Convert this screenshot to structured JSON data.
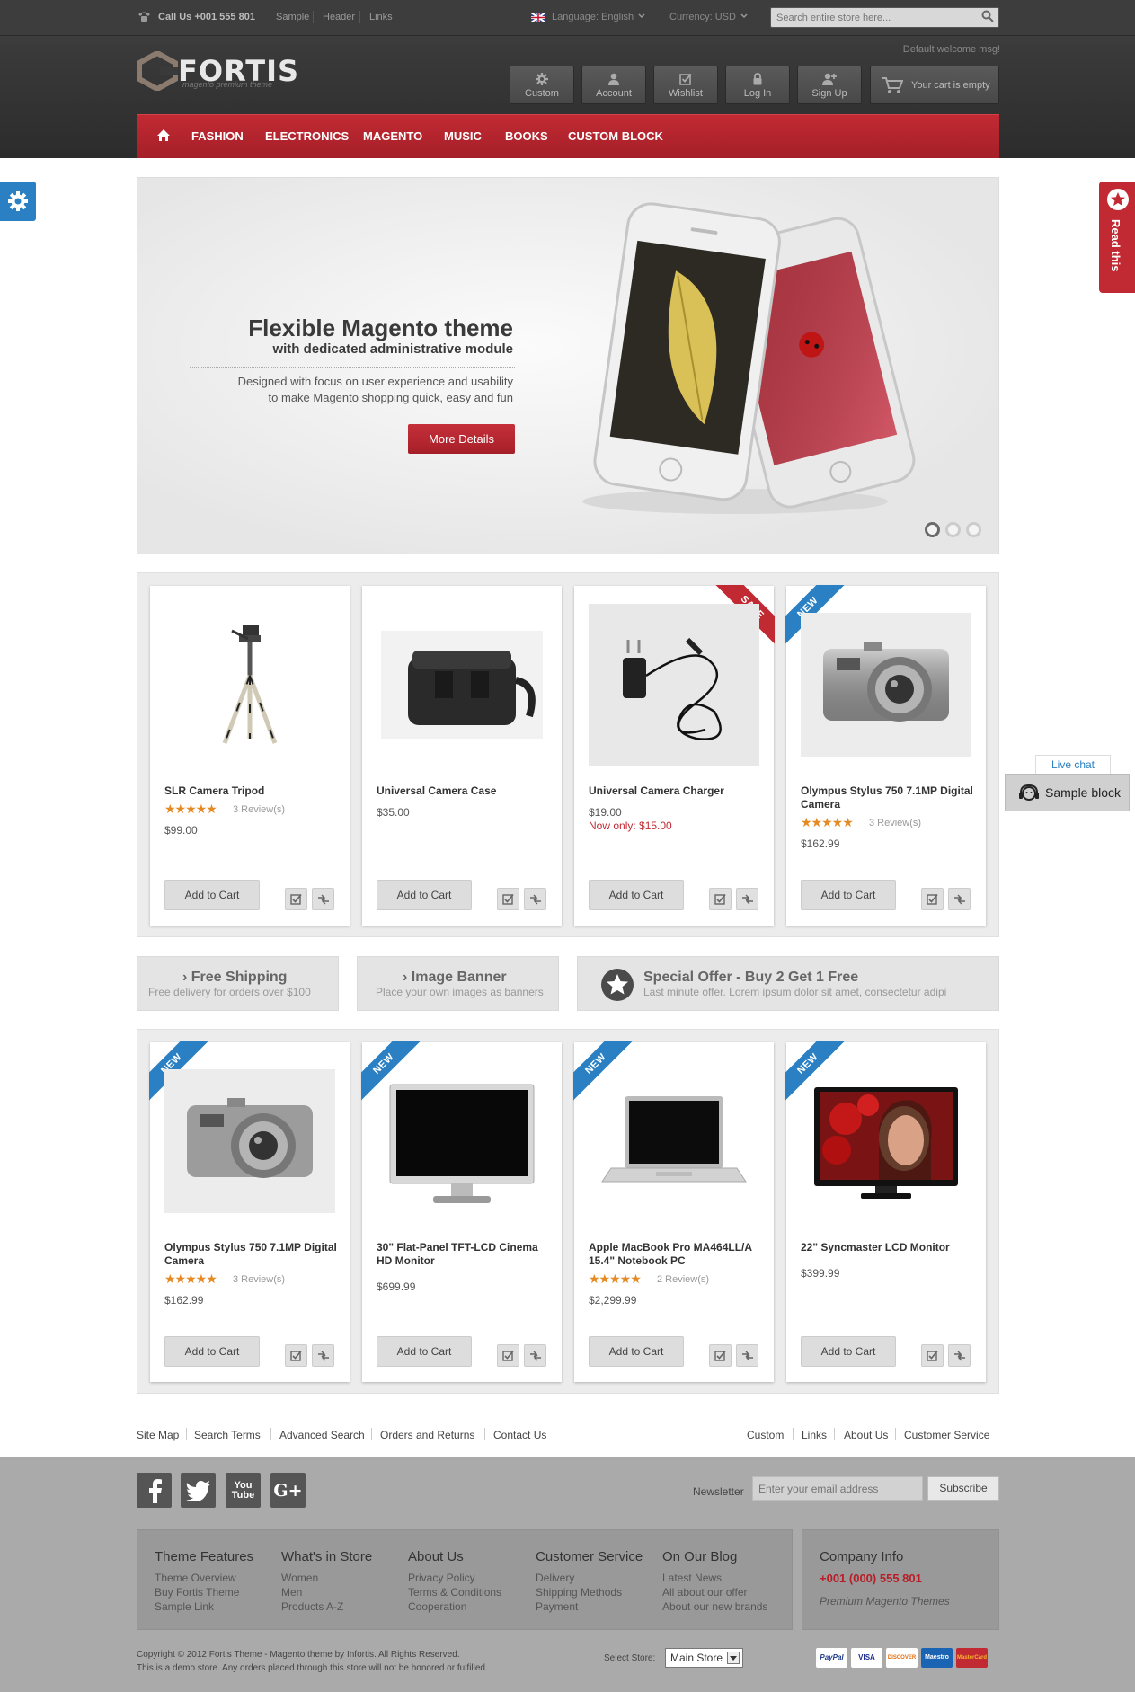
{
  "topbar": {
    "phone": "Call Us +001 555 801",
    "links": [
      "Sample",
      "Header",
      "Links"
    ],
    "language": "Language: English",
    "currency": "Currency: USD",
    "search_placeholder": "Search entire store here..."
  },
  "header": {
    "logo": "FORTIS",
    "logo_tagline": "magento premium theme",
    "welcome": "Default welcome msg!",
    "buttons": [
      {
        "label": "Custom",
        "icon": "gear-icon"
      },
      {
        "label": "Account",
        "icon": "user-icon"
      },
      {
        "label": "Wishlist",
        "icon": "checkbox-icon"
      },
      {
        "label": "Log In",
        "icon": "lock-icon"
      },
      {
        "label": "Sign Up",
        "icon": "user-plus-icon"
      }
    ],
    "cart": "Your cart is empty"
  },
  "nav": {
    "items": [
      "FASHION",
      "ELECTRONICS",
      "MAGENTO",
      "MUSIC",
      "BOOKS",
      "CUSTOM BLOCK"
    ]
  },
  "side": {
    "read_this": "Read this"
  },
  "slider": {
    "title": "Flexible Magento theme",
    "subtitle": "with dedicated administrative module",
    "desc_line1": "Designed with focus on user experience and usability",
    "desc_line2": "to make Magento shopping quick, easy and fun",
    "button": "More Details"
  },
  "products_row1": [
    {
      "name": "SLR Camera Tripod",
      "reviews": "3 Review(s)",
      "rating": 4.5,
      "price": "$99.00",
      "add": "Add to Cart"
    },
    {
      "name": "Universal Camera Case",
      "price": "$35.00",
      "add": "Add to Cart"
    },
    {
      "name": "Universal Camera Charger",
      "price": "$19.00",
      "now": "Now only: $15.00",
      "badge": "SALE",
      "add": "Add to Cart"
    },
    {
      "name": "Olympus Stylus 750 7.1MP Digital Camera",
      "reviews": "3 Review(s)",
      "rating": 4.5,
      "price": "$162.99",
      "badge": "NEW",
      "add": "Add to Cart"
    }
  ],
  "banners": {
    "shipping_title": "Free Shipping",
    "shipping_sub": "Free delivery for orders over $100",
    "image_title": "Image Banner",
    "image_sub": "Place your own images as banners",
    "offer_title": "Special Offer - Buy 2 Get 1 Free",
    "offer_sub": "Last minute offer. Lorem ipsum dolor sit amet, consectetur adipi"
  },
  "products_row2": [
    {
      "name": "Olympus Stylus 750 7.1MP Digital Camera",
      "reviews": "3 Review(s)",
      "rating": 4.5,
      "price": "$162.99",
      "badge": "NEW",
      "add": "Add to Cart"
    },
    {
      "name": "30\" Flat-Panel TFT-LCD Cinema HD Monitor",
      "price": "$699.99",
      "badge": "NEW",
      "add": "Add to Cart"
    },
    {
      "name": "Apple MacBook Pro MA464LL/A 15.4\" Notebook PC",
      "reviews": "2 Review(s)",
      "rating": 5,
      "price": "$2,299.99",
      "badge": "NEW",
      "add": "Add to Cart"
    },
    {
      "name": "22\" Syncmaster LCD Monitor",
      "price": "$399.99",
      "badge": "NEW",
      "add": "Add to Cart"
    }
  ],
  "chat": {
    "live_chat": "Live chat",
    "sample_block": "Sample block"
  },
  "footer_links": {
    "left": [
      "Site Map",
      "Search Terms",
      "Advanced Search",
      "Orders and Returns",
      "Contact Us"
    ],
    "right": [
      "Custom",
      "Links",
      "About Us",
      "Customer Service"
    ]
  },
  "footer": {
    "newsletter_label": "Newsletter",
    "newsletter_placeholder": "Enter your email address",
    "subscribe": "Subscribe",
    "columns": [
      {
        "title": "Theme Features",
        "items": [
          "Theme Overview",
          "Buy Fortis Theme",
          "Sample Link"
        ]
      },
      {
        "title": "What's in Store",
        "items": [
          "Women",
          "Men",
          "Products A-Z"
        ]
      },
      {
        "title": "About Us",
        "items": [
          "Privacy Policy",
          "Terms & Conditions",
          "Cooperation"
        ]
      },
      {
        "title": "Customer Service",
        "items": [
          "Delivery",
          "Shipping Methods",
          "Payment"
        ]
      },
      {
        "title": "On Our Blog",
        "items": [
          "Latest News",
          "All about our offer",
          "About our new brands"
        ]
      }
    ],
    "company_title": "Company Info",
    "company_phone": "+001 (000) 555 801",
    "company_tag": "Premium Magento Themes",
    "copyright1": "Copyright © 2012 Fortis Theme - Magento theme by Infortis. All Rights Reserved.",
    "copyright2": "This is a demo store. Any orders placed through this store will not be honored or fulfilled.",
    "select_store_label": "Select Store:",
    "select_store_value": "Main Store",
    "payments": [
      "PayPal",
      "VISA",
      "DISCOVER",
      "Maestro",
      "MasterCard"
    ]
  },
  "colors": {
    "accent": "#c22a33",
    "blue": "#2a80c3",
    "star": "#e58a23"
  }
}
